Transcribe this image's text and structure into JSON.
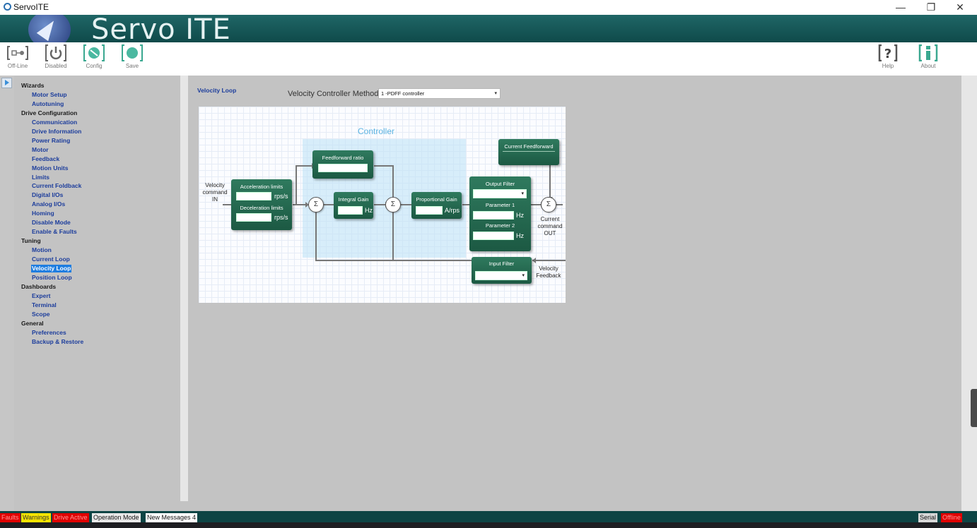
{
  "window": {
    "title": "ServoITE",
    "minimize": "—",
    "restore": "❐",
    "close": "✕"
  },
  "banner": {
    "brand": "Servo ITE"
  },
  "toolbar": {
    "left": [
      {
        "name": "offline",
        "label": "Off-Line"
      },
      {
        "name": "disabled",
        "label": "Disabled"
      },
      {
        "name": "config",
        "label": "Config"
      },
      {
        "name": "save",
        "label": "Save"
      }
    ],
    "right": [
      {
        "name": "help",
        "label": "Help"
      },
      {
        "name": "about",
        "label": "About"
      }
    ]
  },
  "nav": [
    {
      "type": "header",
      "label": "Wizards"
    },
    {
      "type": "item",
      "label": "Motor Setup"
    },
    {
      "type": "item",
      "label": "Autotuning"
    },
    {
      "type": "header",
      "label": "Drive Configuration"
    },
    {
      "type": "item",
      "label": "Communication"
    },
    {
      "type": "item",
      "label": "Drive Information"
    },
    {
      "type": "item",
      "label": "Power Rating"
    },
    {
      "type": "item",
      "label": "Motor"
    },
    {
      "type": "item",
      "label": "Feedback"
    },
    {
      "type": "item",
      "label": "Motion Units"
    },
    {
      "type": "item",
      "label": "Limits"
    },
    {
      "type": "item",
      "label": "Current Foldback"
    },
    {
      "type": "item",
      "label": "Digital I/Os"
    },
    {
      "type": "item",
      "label": "Analog I/Os"
    },
    {
      "type": "item",
      "label": "Homing"
    },
    {
      "type": "item",
      "label": "Disable Mode"
    },
    {
      "type": "item",
      "label": "Enable & Faults"
    },
    {
      "type": "header",
      "label": "Tuning"
    },
    {
      "type": "item",
      "label": "Motion"
    },
    {
      "type": "item",
      "label": "Current Loop"
    },
    {
      "type": "item",
      "label": "Velocity Loop",
      "selected": true
    },
    {
      "type": "item",
      "label": "Position Loop"
    },
    {
      "type": "header",
      "label": "Dashboards"
    },
    {
      "type": "item",
      "label": "Expert"
    },
    {
      "type": "item",
      "label": "Terminal"
    },
    {
      "type": "item",
      "label": "Scope"
    },
    {
      "type": "header",
      "label": "General"
    },
    {
      "type": "item",
      "label": "Preferences"
    },
    {
      "type": "item",
      "label": "Backup & Restore"
    }
  ],
  "main": {
    "page_title": "Velocity Loop",
    "method_label": "Velocity Controller Method",
    "method_value": "1 -PDFF controller"
  },
  "diagram": {
    "controller_label": "Controller",
    "input_label": "Velocity\ncommand\nIN",
    "accel_title": "Acceleration limits",
    "accel_unit": "rps/s",
    "decel_title": "Deceleration limits",
    "decel_unit": "rps/s",
    "ff_title": "Feedforward ratio",
    "integral_title": "Integral Gain",
    "integral_unit": "Hz",
    "prop_title": "Proportional Gain",
    "prop_unit": "A/rps",
    "output_filter_title": "Output Filter",
    "param1_title": "Parameter 1",
    "param1_unit": "Hz",
    "param2_title": "Parameter 2",
    "param2_unit": "Hz",
    "current_ff_title": "Current Feedforward",
    "output_label": "Current\ncommand\nOUT",
    "input_filter_title": "Input Filter",
    "feedback_label": "Velocity\nFeedback",
    "sum_symbol": "Σ"
  },
  "status": {
    "faults": "Faults",
    "warnings": "Warnings",
    "drive_active": "Drive Active",
    "operation_mode": "Operation Mode",
    "new_messages": "New Messages 4",
    "serial": "Serial",
    "offline": "Offline"
  },
  "colors": {
    "banner": "#0f4a4a",
    "block": "#1c5943",
    "selected": "#1e7de0",
    "fault": "#e00000",
    "warning": "#f5e400"
  }
}
